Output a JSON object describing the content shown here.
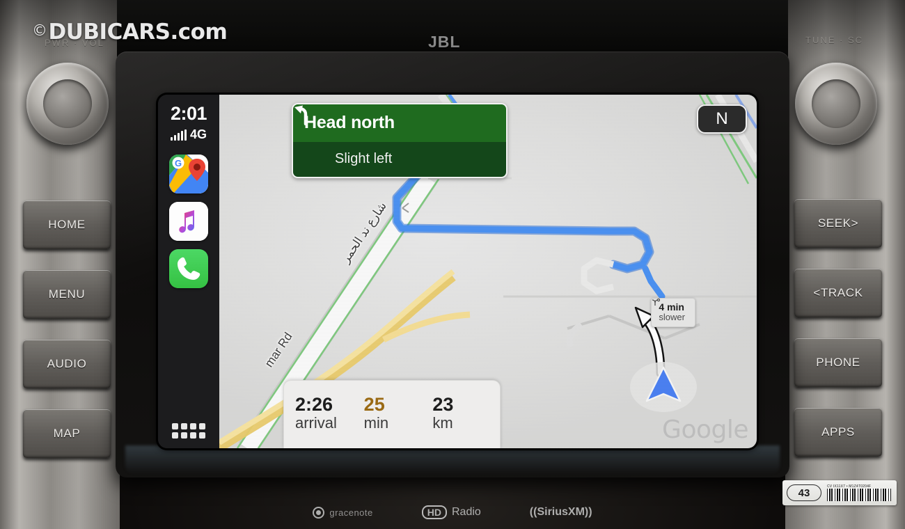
{
  "watermark": {
    "symbol": "©",
    "text": "DUBICARS.com"
  },
  "dashboard": {
    "brand_logo": "JBL",
    "left_knob_label": "PWR · VOL",
    "right_knob_label": "TUNE · SC",
    "left_buttons": [
      {
        "label": "HOME",
        "name": "home-button"
      },
      {
        "label": "MENU",
        "name": "menu-button"
      },
      {
        "label": "AUDIO",
        "name": "audio-button"
      },
      {
        "label": "MAP",
        "name": "map-button"
      }
    ],
    "right_buttons": [
      {
        "label": "SEEK>",
        "name": "seek-button"
      },
      {
        "label": "<TRACK",
        "name": "track-button"
      },
      {
        "label": "PHONE",
        "name": "phone-button"
      },
      {
        "label": "APPS",
        "name": "apps-button"
      }
    ],
    "footer_logos": [
      {
        "text": "gracenote",
        "icon": "gracenote-icon"
      },
      {
        "text": "Radio",
        "icon": "hd-radio-icon",
        "mark": "HD"
      },
      {
        "text": "((SiriusXM))",
        "icon": "siriusxm-icon"
      }
    ],
    "sticker": {
      "number": "43",
      "code": "CV IX11X7 • M1Z4T0204F"
    }
  },
  "carplay": {
    "status": {
      "time": "2:01",
      "network": "4G",
      "signal_bars": 5
    },
    "dock": [
      {
        "name": "google-maps-app-icon",
        "label": "Google Maps"
      },
      {
        "name": "apple-music-app-icon",
        "label": "Music"
      },
      {
        "name": "phone-app-icon",
        "label": "Phone"
      }
    ],
    "launcher_label": "App Grid"
  },
  "navigation": {
    "banner": {
      "primary": "Head north",
      "next_maneuver": "Slight left",
      "maneuver_icon": "slight-left-arrow-icon"
    },
    "compass": {
      "label": "N",
      "name": "compass-north-button"
    },
    "eta": [
      {
        "value": "2:26",
        "unit": "arrival",
        "accent": false
      },
      {
        "value": "25",
        "unit": "min",
        "accent": true
      },
      {
        "value": "23",
        "unit": "km",
        "accent": false
      }
    ],
    "alt_route": {
      "delta": "4 min",
      "note": "slower",
      "icon": "route-fork-icon"
    },
    "road_labels": [
      {
        "text": "شارع ند الحمر",
        "name": "road-label-arabic"
      },
      {
        "text": "mar Rd",
        "name": "road-label-latin"
      }
    ],
    "map_attribution": "Google",
    "colors": {
      "route": "#4a90f0",
      "highway": "#f3d98f",
      "park_edge": "#7ec87e",
      "banner_green": "#1f6b1f",
      "accent_orange": "#9a6a14"
    }
  }
}
